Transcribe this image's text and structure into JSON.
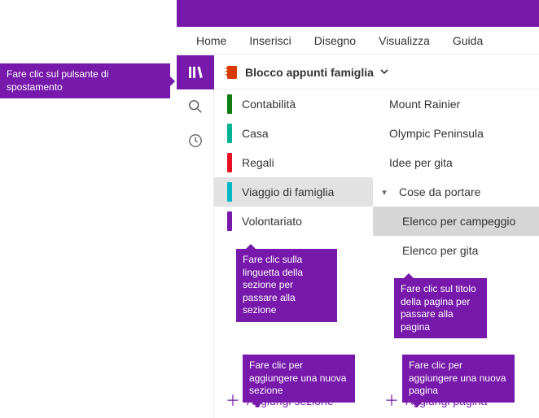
{
  "callouts": {
    "nav_button": "Fare clic sul pulsante di spostamento",
    "section_tab": "Fare clic sulla linguetta della sezione per passare alla sezione",
    "page_title": "Fare clic sul titolo della pagina per passare alla pagina",
    "add_section": "Fare clic per aggiungere una nuova sezione",
    "add_page": "Fare clic per aggiungere una nuova pagina"
  },
  "ribbon": {
    "tabs": [
      "Home",
      "Inserisci",
      "Disegno",
      "Visualizza",
      "Guida"
    ]
  },
  "notebook": {
    "title": "Blocco appunti famiglia"
  },
  "sections": [
    {
      "label": "Contabilità",
      "color": "#107c10",
      "selected": false
    },
    {
      "label": "Casa",
      "color": "#00b294",
      "selected": false
    },
    {
      "label": "Regali",
      "color": "#e81123",
      "selected": false
    },
    {
      "label": "Viaggio di famiglia",
      "color": "#00b7c3",
      "selected": true
    },
    {
      "label": "Volontariato",
      "color": "#7719aa",
      "selected": false
    }
  ],
  "pages": [
    {
      "label": "Mount Rainier",
      "indent": false,
      "selected": false,
      "expandable": false
    },
    {
      "label": "Olympic Peninsula",
      "indent": false,
      "selected": false,
      "expandable": false
    },
    {
      "label": "Idee per gita",
      "indent": false,
      "selected": false,
      "expandable": false
    },
    {
      "label": "Cose da portare",
      "indent": false,
      "selected": false,
      "expandable": true
    },
    {
      "label": "Elenco per campeggio",
      "indent": true,
      "selected": true,
      "expandable": false
    },
    {
      "label": "Elenco per gita",
      "indent": true,
      "selected": false,
      "expandable": false
    }
  ],
  "add": {
    "section_label": "Aggiungi sezione",
    "page_label": "Aggiungi pagina"
  }
}
